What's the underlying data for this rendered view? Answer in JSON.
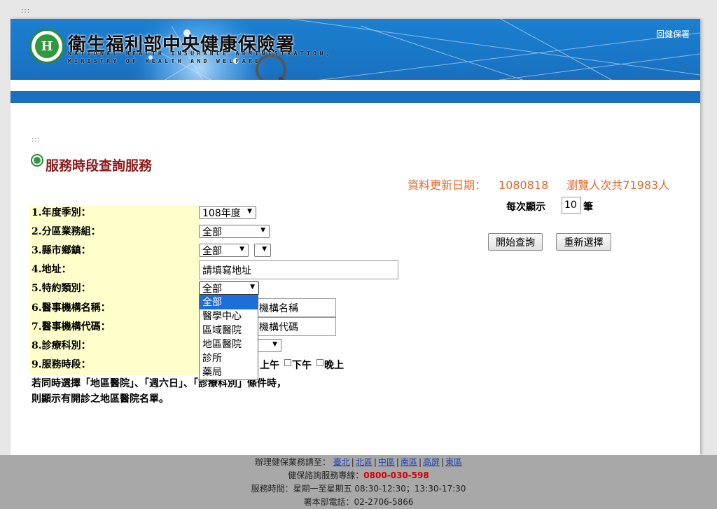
{
  "top_dots": ":::",
  "banner": {
    "agency_zh": "衛生福利部中央健康保險署",
    "agency_en_line1": "NATIONAL HEALTH INSURANCE ADMINISTRATION,",
    "agency_en_line2": "MINISTRY OF HEALTH AND WELFARE",
    "logo_glyph": "H",
    "home_link": "回健保署",
    "colors": {
      "primary": "#1a74c4",
      "logo_green": "#2f9a3c"
    }
  },
  "mid_dots": ":::",
  "page_title": "服務時段查詢服務",
  "update": {
    "label": "資料更新日期：",
    "date": "1080818",
    "views": "瀏覽人次共71983人"
  },
  "form": {
    "labels": {
      "year_season": "1.年度季別：",
      "district": "2.分區業務組：",
      "county_town": "3.縣市鄉鎮：",
      "address": "4.地址：",
      "contract_type": "5.特約類別：",
      "institution_name": "6.醫事機構名稱：",
      "institution_code": "7.醫事機構代碼：",
      "department": "8.診療科別：",
      "service_time": "9.服務時段："
    },
    "year_season_value": "108年度",
    "district_value": "全部",
    "county_value": "全部",
    "town_value": "",
    "address_value": "請填寫地址",
    "contract_type_value": "全部",
    "institution_name_partial": "機構名稱",
    "institution_code_partial": "機構代碼",
    "contract_type_options": [
      "全部",
      "醫學中心",
      "區域醫院",
      "地區醫院",
      "診所",
      "藥局"
    ],
    "time_options": [
      "上午",
      "下午",
      "晚上"
    ],
    "note_line1": "若同時選擇「地區醫院」、「週六日」、「診療科別」條件時，",
    "note_line2": "則顯示有開診之地區醫院名單。"
  },
  "controls": {
    "per_page_label": "每次顯示",
    "per_page_value": "10",
    "per_page_unit": "筆",
    "search_button": "開始查詢",
    "reset_button": "重新選擇"
  },
  "footer": {
    "line1_prefix": "辦理健保業務請至：",
    "regions": [
      "臺北",
      "北區",
      "中區",
      "南區",
      "高屏",
      "東區"
    ],
    "line2_prefix": "健保諮詢服務專線：",
    "hotline": "0800-030-598",
    "line3": "服務時間：星期一至星期五 08:30-12:30；13:30-17:30",
    "line4": "署本部電話：02-2706-5866",
    "separator": "|"
  }
}
